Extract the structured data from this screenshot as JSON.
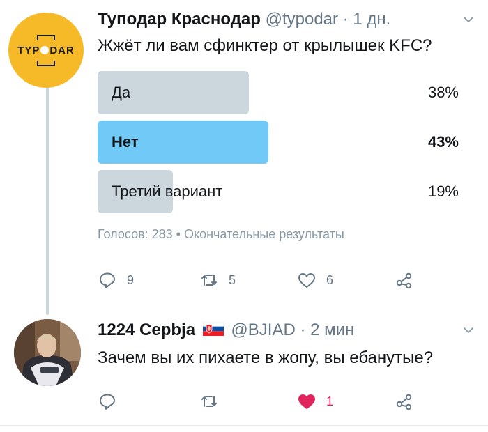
{
  "tweet1": {
    "avatar_text": "TYPODAR",
    "avatar_text_left": "TYP",
    "avatar_text_right": "DAR",
    "author_name": "Туподар Краснодар",
    "handle_time": "@typodar · 1 дн.",
    "text": "Жжёт ли вам сфинктер от крылышек KFC?",
    "poll": {
      "options": [
        {
          "label": "Да",
          "percent_text": "38%",
          "percent": 38,
          "winner": false
        },
        {
          "label": "Нет",
          "percent_text": "43%",
          "percent": 43,
          "winner": true
        },
        {
          "label": "Третий вариант",
          "percent_text": "19%",
          "percent": 19,
          "winner": false
        }
      ],
      "meta": "Голосов: 283 • Окончательные результаты"
    },
    "actions": {
      "reply_count": "9",
      "retweet_count": "5",
      "like_count": "6"
    }
  },
  "tweet2": {
    "author_name": "1224 Cepbja",
    "handle_time": "@BJIAD · 2 мин",
    "text": "Зачем вы их пихаете в жопу, вы ебанутые?",
    "actions": {
      "like_count": "1"
    }
  },
  "colors": {
    "brand_yellow": "#f6b928",
    "poll_grey": "#ccd6dd",
    "poll_winner": "#71c9f8",
    "icon_grey": "#657786",
    "heart_red": "#e0245e",
    "thread_line": "#ccd6dd"
  }
}
